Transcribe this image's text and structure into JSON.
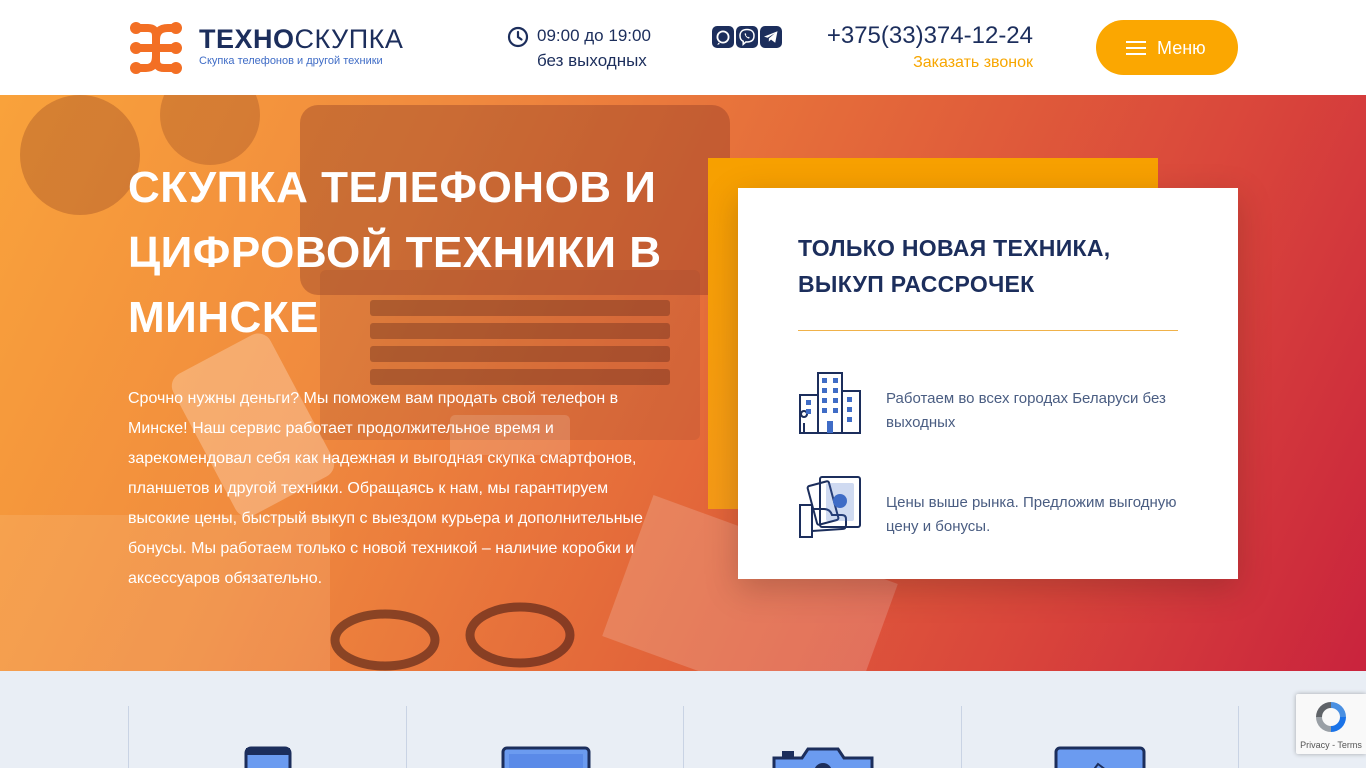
{
  "header": {
    "logo_bold": "ТЕХНО",
    "logo_rest": "СКУПКА",
    "logo_subtitle": "Скупка телефонов и другой техники",
    "hours_line1": "09:00 до 19:00",
    "hours_line2": "без выходных",
    "messengers": [
      {
        "icon": "whatsapp-icon"
      },
      {
        "icon": "viber-icon"
      },
      {
        "icon": "telegram-icon"
      }
    ],
    "phone": "+375(33)374-12-24",
    "callback_label": "Заказать звонок",
    "menu_label": "Меню"
  },
  "hero": {
    "title": "СКУПКА ТЕЛЕФОНОВ И ЦИФРОВОЙ ТЕХНИКИ В МИНСКЕ",
    "text": "Срочно нужны деньги? Мы поможем вам продать свой телефон в Минске! Наш сервис работает продолжительное время и зарекомендовал себя как надежная и выгодная скупка смартфонов, планшетов и другой техники. Обращаясь к нам, мы гарантируем высокие цены, быстрый выкуп с выездом курьера и дополнительные бонусы. Мы работаем только с новой техникой – наличие коробки и аксессуаров обязательно."
  },
  "card": {
    "title": "ТОЛЬКО НОВАЯ ТЕХНИКА, ВЫКУП РАССРОЧЕК",
    "features": [
      {
        "icon": "city-buildings-icon",
        "text": "Работаем во всех городах Беларуси без выходных"
      },
      {
        "icon": "money-in-hand-icon",
        "text": "Цены выше рынка. Предложим выгодную цену и бонусы."
      }
    ]
  },
  "categories": [
    {
      "icon": "phone-icon"
    },
    {
      "icon": "laptop-icon"
    },
    {
      "icon": "camera-icon"
    },
    {
      "icon": "monitor-icon"
    }
  ],
  "recaptcha": {
    "links": "Privacy - Terms"
  },
  "colors": {
    "brand_orange": "#fba701",
    "brand_navy": "#1c2e5c",
    "link_blue": "#3f6cc6",
    "hero_gradient_start": "#f9a23b",
    "hero_gradient_end": "#c9233d"
  }
}
